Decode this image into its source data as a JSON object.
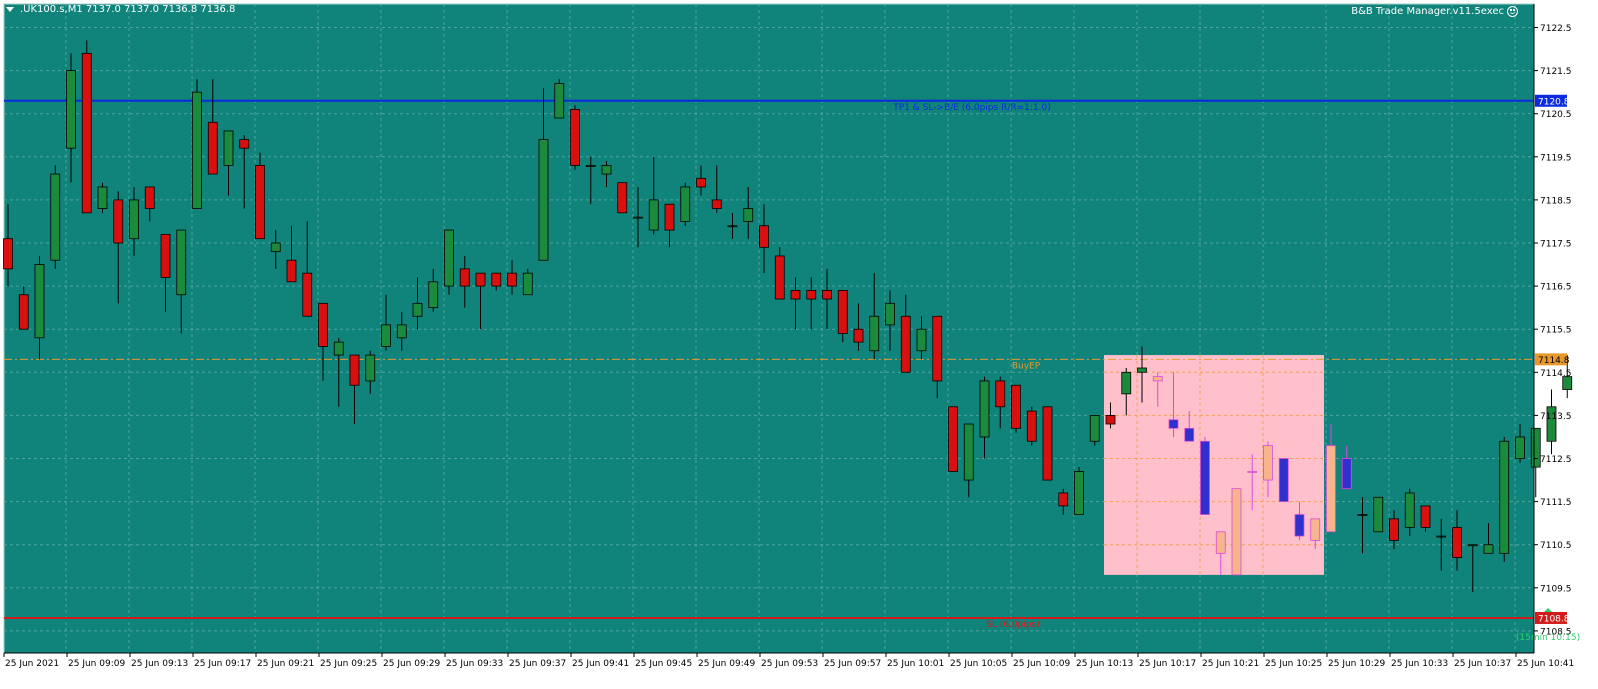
{
  "header": {
    "symbol_line": ".UK100.s,M1  7137.0 7137.0 7136.8 7136.8",
    "ea_name": "B&B Trade Manager.v11.5exec"
  },
  "colors": {
    "background": "#10837a",
    "grid": "#4ea59d",
    "bull_fill": "#1b8a3c",
    "bear_fill": "#d91010",
    "wick": "#000000",
    "tp_line": "#0b2bdd",
    "sl_line": "#d21c1c",
    "buy_ep_line": "#e79a2b",
    "zone_fill": "#ffc0cb",
    "zone_grid": "#f2a05a",
    "zone_bull_fill": "#f6b48e",
    "zone_bear_fill": "#3030cc",
    "zone_wick": "#d84bd8",
    "arrow": "#2bd36b"
  },
  "levels": {
    "tp": {
      "price": 7120.8,
      "tag": "7120.8",
      "label": "TP1 & SL->B/E (6.0pips R/R=1:1.0)"
    },
    "buy_ep": {
      "price": 7114.8,
      "tag": "7114.8",
      "label": "BuyEP"
    },
    "sl": {
      "price": 7108.8,
      "tag": "7108.8",
      "label": "SL (6.0pips)"
    }
  },
  "signal": {
    "icon": "up-arrow-icon",
    "label": "(15min 10:15)"
  },
  "chart_data": {
    "type": "candlestick",
    "symbol": ".UK100.s",
    "timeframe": "M1",
    "ylim": [
      7107.8,
      7122.8
    ],
    "y_ticks": [
      7122.5,
      7121.5,
      7120.5,
      7119.5,
      7118.5,
      7117.5,
      7116.5,
      7115.5,
      7114.5,
      7113.5,
      7112.5,
      7111.5,
      7110.5,
      7109.5,
      7108.5
    ],
    "y_tick_labels": [
      "7122.5",
      "7121.5",
      "7120.5",
      "7119.5",
      "7118.5",
      "7117.5",
      "7116.5",
      "7115.5",
      "7114.5",
      "7113.5",
      "7112.5",
      "7111.5",
      "7110.5",
      "7109.5",
      "7108.5"
    ],
    "x_tick_labels": [
      "25 Jun 2021",
      "25 Jun 09:09",
      "25 Jun 09:13",
      "25 Jun 09:17",
      "25 Jun 09:21",
      "25 Jun 09:25",
      "25 Jun 09:29",
      "25 Jun 09:33",
      "25 Jun 09:37",
      "25 Jun 09:41",
      "25 Jun 09:45",
      "25 Jun 09:49",
      "25 Jun 09:53",
      "25 Jun 09:57",
      "25 Jun 10:01",
      "25 Jun 10:05",
      "25 Jun 10:09",
      "25 Jun 10:13",
      "25 Jun 10:17",
      "25 Jun 10:21",
      "25 Jun 10:25",
      "25 Jun 10:29",
      "25 Jun 10:33",
      "25 Jun 10:37",
      "25 Jun 10:41"
    ],
    "candles": [
      {
        "o": 7117.6,
        "h": 7118.4,
        "l": 7116.5,
        "c": 7116.9
      },
      {
        "o": 7116.3,
        "h": 7116.5,
        "l": 7115.5,
        "c": 7115.5
      },
      {
        "o": 7115.3,
        "h": 7117.2,
        "l": 7114.8,
        "c": 7117.0
      },
      {
        "o": 7117.1,
        "h": 7119.3,
        "l": 7116.9,
        "c": 7119.1
      },
      {
        "o": 7119.7,
        "h": 7121.9,
        "l": 7118.9,
        "c": 7121.5
      },
      {
        "o": 7121.9,
        "h": 7122.2,
        "l": 7118.3,
        "c": 7118.2
      },
      {
        "o": 7118.3,
        "h": 7118.9,
        "l": 7118.2,
        "c": 7118.8
      },
      {
        "o": 7118.5,
        "h": 7118.7,
        "l": 7116.1,
        "c": 7117.5
      },
      {
        "o": 7117.6,
        "h": 7118.8,
        "l": 7117.2,
        "c": 7118.5
      },
      {
        "o": 7118.8,
        "h": 7118.8,
        "l": 7118.0,
        "c": 7118.3
      },
      {
        "o": 7117.7,
        "h": 7117.7,
        "l": 7115.9,
        "c": 7116.7
      },
      {
        "o": 7116.3,
        "h": 7117.8,
        "l": 7115.4,
        "c": 7117.8
      },
      {
        "o": 7118.3,
        "h": 7121.3,
        "l": 7118.3,
        "c": 7121.0
      },
      {
        "o": 7120.3,
        "h": 7121.3,
        "l": 7119.1,
        "c": 7119.1
      },
      {
        "o": 7119.3,
        "h": 7120.1,
        "l": 7118.6,
        "c": 7120.1
      },
      {
        "o": 7119.9,
        "h": 7120.0,
        "l": 7118.3,
        "c": 7119.7
      },
      {
        "o": 7119.3,
        "h": 7119.6,
        "l": 7117.6,
        "c": 7117.6
      },
      {
        "o": 7117.3,
        "h": 7117.8,
        "l": 7116.9,
        "c": 7117.5
      },
      {
        "o": 7117.1,
        "h": 7117.9,
        "l": 7116.6,
        "c": 7116.6
      },
      {
        "o": 7116.8,
        "h": 7118.0,
        "l": 7115.8,
        "c": 7115.8
      },
      {
        "o": 7116.1,
        "h": 7116.1,
        "l": 7114.3,
        "c": 7115.1
      },
      {
        "o": 7114.9,
        "h": 7115.3,
        "l": 7113.7,
        "c": 7115.2
      },
      {
        "o": 7114.9,
        "h": 7114.9,
        "l": 7113.3,
        "c": 7114.2
      },
      {
        "o": 7114.3,
        "h": 7115.0,
        "l": 7114.0,
        "c": 7114.9
      },
      {
        "o": 7115.1,
        "h": 7116.3,
        "l": 7115.0,
        "c": 7115.6
      },
      {
        "o": 7115.3,
        "h": 7115.9,
        "l": 7115.0,
        "c": 7115.6
      },
      {
        "o": 7115.8,
        "h": 7116.7,
        "l": 7115.5,
        "c": 7116.1
      },
      {
        "o": 7116.0,
        "h": 7116.9,
        "l": 7115.9,
        "c": 7116.6
      },
      {
        "o": 7116.5,
        "h": 7117.8,
        "l": 7116.3,
        "c": 7117.8
      },
      {
        "o": 7116.9,
        "h": 7117.2,
        "l": 7116.0,
        "c": 7116.5
      },
      {
        "o": 7116.8,
        "h": 7116.8,
        "l": 7115.5,
        "c": 7116.5
      },
      {
        "o": 7116.8,
        "h": 7116.8,
        "l": 7116.4,
        "c": 7116.5
      },
      {
        "o": 7116.8,
        "h": 7117.1,
        "l": 7116.3,
        "c": 7116.5
      },
      {
        "o": 7116.3,
        "h": 7116.9,
        "l": 7116.3,
        "c": 7116.8
      },
      {
        "o": 7117.1,
        "h": 7121.1,
        "l": 7117.1,
        "c": 7119.9
      },
      {
        "o": 7120.4,
        "h": 7121.3,
        "l": 7120.4,
        "c": 7121.2
      },
      {
        "o": 7120.6,
        "h": 7120.7,
        "l": 7119.2,
        "c": 7119.3
      },
      {
        "o": 7119.3,
        "h": 7119.5,
        "l": 7118.4,
        "c": 7119.3
      },
      {
        "o": 7119.1,
        "h": 7119.4,
        "l": 7118.8,
        "c": 7119.3
      },
      {
        "o": 7118.9,
        "h": 7118.9,
        "l": 7118.4,
        "c": 7118.2
      },
      {
        "o": 7118.1,
        "h": 7118.8,
        "l": 7117.4,
        "c": 7118.1
      },
      {
        "o": 7117.8,
        "h": 7119.5,
        "l": 7117.7,
        "c": 7118.5
      },
      {
        "o": 7118.4,
        "h": 7118.4,
        "l": 7117.4,
        "c": 7117.8
      },
      {
        "o": 7118.0,
        "h": 7118.9,
        "l": 7117.9,
        "c": 7118.8
      },
      {
        "o": 7119.0,
        "h": 7119.3,
        "l": 7118.6,
        "c": 7118.8
      },
      {
        "o": 7118.5,
        "h": 7119.3,
        "l": 7118.2,
        "c": 7118.3
      },
      {
        "o": 7117.9,
        "h": 7118.2,
        "l": 7117.6,
        "c": 7117.9
      },
      {
        "o": 7118.0,
        "h": 7118.8,
        "l": 7117.6,
        "c": 7118.3
      },
      {
        "o": 7117.9,
        "h": 7118.4,
        "l": 7116.8,
        "c": 7117.4
      },
      {
        "o": 7117.2,
        "h": 7117.4,
        "l": 7116.2,
        "c": 7116.2
      },
      {
        "o": 7116.4,
        "h": 7116.7,
        "l": 7115.5,
        "c": 7116.2
      },
      {
        "o": 7116.4,
        "h": 7116.7,
        "l": 7115.5,
        "c": 7116.2
      },
      {
        "o": 7116.4,
        "h": 7116.9,
        "l": 7115.5,
        "c": 7116.2
      },
      {
        "o": 7116.4,
        "h": 7116.4,
        "l": 7115.2,
        "c": 7115.4
      },
      {
        "o": 7115.5,
        "h": 7116.1,
        "l": 7115.0,
        "c": 7115.2
      },
      {
        "o": 7115.0,
        "h": 7116.8,
        "l": 7114.8,
        "c": 7115.8
      },
      {
        "o": 7115.6,
        "h": 7116.4,
        "l": 7115.0,
        "c": 7116.1
      },
      {
        "o": 7115.8,
        "h": 7116.3,
        "l": 7114.5,
        "c": 7114.5
      },
      {
        "o": 7115.0,
        "h": 7115.8,
        "l": 7114.8,
        "c": 7115.5
      },
      {
        "o": 7115.8,
        "h": 7115.8,
        "l": 7113.9,
        "c": 7114.3
      },
      {
        "o": 7113.7,
        "h": 7113.7,
        "l": 7112.2,
        "c": 7112.2
      },
      {
        "o": 7112.0,
        "h": 7113.3,
        "l": 7111.6,
        "c": 7113.3
      },
      {
        "o": 7113.0,
        "h": 7114.4,
        "l": 7112.5,
        "c": 7114.3
      },
      {
        "o": 7114.3,
        "h": 7114.4,
        "l": 7113.2,
        "c": 7113.7
      },
      {
        "o": 7114.2,
        "h": 7114.2,
        "l": 7113.1,
        "c": 7113.2
      },
      {
        "o": 7113.6,
        "h": 7113.7,
        "l": 7112.8,
        "c": 7112.9
      },
      {
        "o": 7113.7,
        "h": 7113.7,
        "l": 7112.0,
        "c": 7112.0
      },
      {
        "o": 7111.7,
        "h": 7111.8,
        "l": 7111.2,
        "c": 7111.4
      },
      {
        "o": 7111.2,
        "h": 7112.3,
        "l": 7111.2,
        "c": 7112.2
      },
      {
        "o": 7112.9,
        "h": 7113.5,
        "l": 7112.8,
        "c": 7113.5
      },
      {
        "o": 7113.5,
        "h": 7113.8,
        "l": 7113.2,
        "c": 7113.3
      },
      {
        "o": 7114.0,
        "h": 7114.6,
        "l": 7113.5,
        "c": 7114.5
      },
      {
        "o": 7114.5,
        "h": 7115.1,
        "l": 7113.8,
        "c": 7114.6
      }
    ],
    "zone": {
      "label": "",
      "price_top": 7114.9,
      "price_bottom": 7109.8,
      "candles": [
        {
          "o": 7114.3,
          "h": 7114.5,
          "l": 7113.7,
          "c": 7114.4
        },
        {
          "o": 7113.4,
          "h": 7114.5,
          "l": 7113.0,
          "c": 7113.2
        },
        {
          "o": 7113.2,
          "h": 7113.6,
          "l": 7112.9,
          "c": 7112.9
        },
        {
          "o": 7112.9,
          "h": 7113.0,
          "l": 7111.2,
          "c": 7111.2
        },
        {
          "o": 7110.3,
          "h": 7110.8,
          "l": 7109.8,
          "c": 7110.8
        },
        {
          "o": 7109.8,
          "h": 7111.8,
          "l": 7109.8,
          "c": 7111.8
        },
        {
          "o": 7112.2,
          "h": 7112.6,
          "l": 7111.3,
          "c": 7112.2
        },
        {
          "o": 7112.0,
          "h": 7112.9,
          "l": 7111.6,
          "c": 7112.8
        },
        {
          "o": 7112.5,
          "h": 7112.5,
          "l": 7111.5,
          "c": 7111.5
        },
        {
          "o": 7111.2,
          "h": 7111.5,
          "l": 7110.6,
          "c": 7110.7
        },
        {
          "o": 7110.6,
          "h": 7111.1,
          "l": 7110.4,
          "c": 7111.1
        },
        {
          "o": 7110.8,
          "h": 7113.3,
          "l": 7110.8,
          "c": 7112.8
        },
        {
          "o": 7112.5,
          "h": 7112.8,
          "l": 7111.8,
          "c": 7111.8
        }
      ]
    },
    "after": [
      {
        "o": 7111.2,
        "h": 7111.6,
        "l": 7110.3,
        "c": 7111.2
      },
      {
        "o": 7110.8,
        "h": 7111.6,
        "l": 7110.8,
        "c": 7111.6
      },
      {
        "o": 7111.1,
        "h": 7111.3,
        "l": 7110.4,
        "c": 7110.6
      },
      {
        "o": 7110.9,
        "h": 7111.8,
        "l": 7110.7,
        "c": 7111.7
      },
      {
        "o": 7111.4,
        "h": 7111.4,
        "l": 7110.8,
        "c": 7110.9
      },
      {
        "o": 7110.7,
        "h": 7111.1,
        "l": 7109.9,
        "c": 7110.7
      },
      {
        "o": 7110.9,
        "h": 7111.3,
        "l": 7109.9,
        "c": 7110.2
      },
      {
        "o": 7110.5,
        "h": 7110.5,
        "l": 7109.4,
        "c": 7110.5
      },
      {
        "o": 7110.3,
        "h": 7111.0,
        "l": 7110.3,
        "c": 7110.5
      },
      {
        "o": 7110.3,
        "h": 7113.0,
        "l": 7110.1,
        "c": 7112.9
      },
      {
        "o": 7112.5,
        "h": 7113.3,
        "l": 7112.4,
        "c": 7113.0
      },
      {
        "o": 7112.3,
        "h": 7113.2,
        "l": 7111.6,
        "c": 7113.2
      },
      {
        "o": 7112.9,
        "h": 7114.1,
        "l": 7112.6,
        "c": 7113.7
      },
      {
        "o": 7114.1,
        "h": 7114.9,
        "l": 7113.9,
        "c": 7114.4
      }
    ]
  }
}
